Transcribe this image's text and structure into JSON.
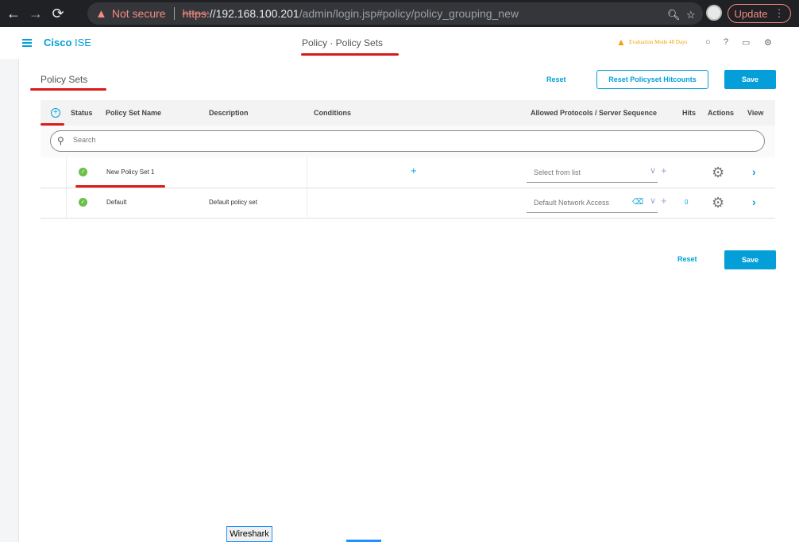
{
  "browser": {
    "warning_text": "Not secure",
    "url_scheme": "https:",
    "url_host": "//192.168.100.201",
    "url_path": "/admin/login.jsp#policy/policy_grouping_new",
    "update_label": "Update"
  },
  "header": {
    "brand_bold": "Cisco",
    "brand_rest": " ISE",
    "title": "Policy · Policy Sets",
    "evaluation": "Evaluation Mode 48 Days"
  },
  "section": {
    "title": "Policy Sets",
    "reset_label": "Reset",
    "reset_hitcounts_label": "Reset Policyset Hitcounts",
    "save_label": "Save"
  },
  "table": {
    "columns": [
      "Status",
      "Policy Set Name",
      "Description",
      "Conditions",
      "Allowed Protocols / Server Sequence",
      "Hits",
      "Actions",
      "View"
    ],
    "search_placeholder": "Search",
    "rows": [
      {
        "name": "New Policy Set 1",
        "description": "",
        "protocol": "Select from list",
        "hits": ""
      },
      {
        "name": "Default",
        "description": "Default policy set",
        "protocol": "Default Network Access",
        "hits": "0"
      }
    ]
  },
  "footer": {
    "reset_label": "Reset",
    "save_label": "Save"
  },
  "taskbar": {
    "wireshark_label": "Wireshark"
  },
  "colors": {
    "accent": "#049fd9",
    "status_enabled": "#6cc04a",
    "annotation": "#d81b1b",
    "warning": "#f0a30a"
  }
}
